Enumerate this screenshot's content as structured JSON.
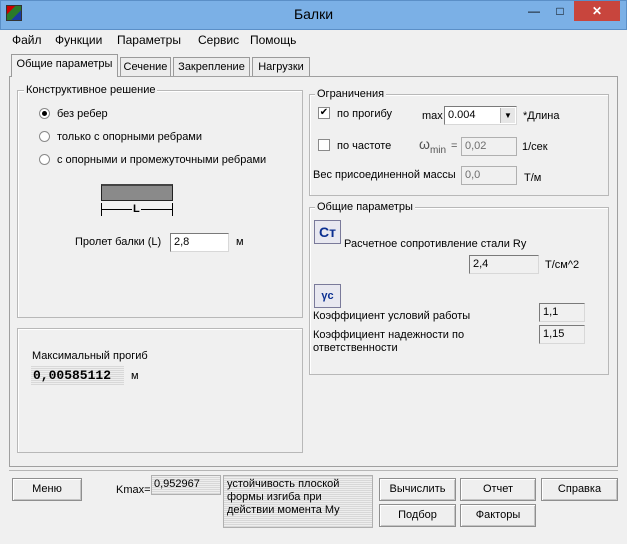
{
  "window": {
    "title": "Балки",
    "minimize_glyph": "—",
    "maximize_glyph": "□",
    "close_glyph": "✕"
  },
  "menu": {
    "items": [
      "Файл",
      "Функции",
      "Параметры",
      "Сервис",
      "Помощь"
    ]
  },
  "tabs": [
    {
      "label": "Общие параметры",
      "active": true
    },
    {
      "label": "Сечение",
      "active": false
    },
    {
      "label": "Закрепление",
      "active": false
    },
    {
      "label": "Нагрузки",
      "active": false
    }
  ],
  "construction": {
    "legend": "Конструктивное решение",
    "options": [
      "без ребер",
      "только с опорными ребрами",
      "с опорными и промежуточными ребрами"
    ],
    "selected_index": 0,
    "beam_label": "L",
    "span_label": "Пролет балки (L)",
    "span_value": "2,8",
    "span_unit": "м"
  },
  "deflection": {
    "label": "Максимальный прогиб",
    "value": "0,00585112",
    "unit": "м"
  },
  "constraints": {
    "legend": "Ограничения",
    "by_deflection": {
      "label": "по прогибу",
      "checked": true,
      "max_label": "max",
      "value": "0.004",
      "suffix": "*Длина"
    },
    "by_frequency": {
      "label": "по частоте",
      "checked": false,
      "omega_label": "ω",
      "omega_sub": "min",
      "eq": "=",
      "value": "0,02",
      "unit": "1/сек"
    },
    "mass": {
      "label": "Вес присоединенной массы",
      "value": "0,0",
      "unit": "Т/м"
    }
  },
  "general": {
    "legend": "Общие параметры",
    "steel_button": "Ст",
    "steel_label": "Расчетное сопротивление стали Ry",
    "steel_value": "2,4",
    "steel_unit": "Т/см^2",
    "gamma_button": "γc",
    "work_label": "Коэффициент условий работы",
    "work_value": "1,1",
    "reliability_label": "Коэффициент надежности по ответственности",
    "reliability_value": "1,15"
  },
  "footer": {
    "menu_button": "Меню",
    "kmax_label": "Kmax=",
    "kmax_value": "0,952967",
    "status_text": "устойчивость плоской формы изгиба при действии момента My",
    "calc_button": "Вычислить",
    "report_button": "Отчет",
    "help_button": "Справка",
    "select_button": "Подбор",
    "factors_button": "Факторы"
  }
}
